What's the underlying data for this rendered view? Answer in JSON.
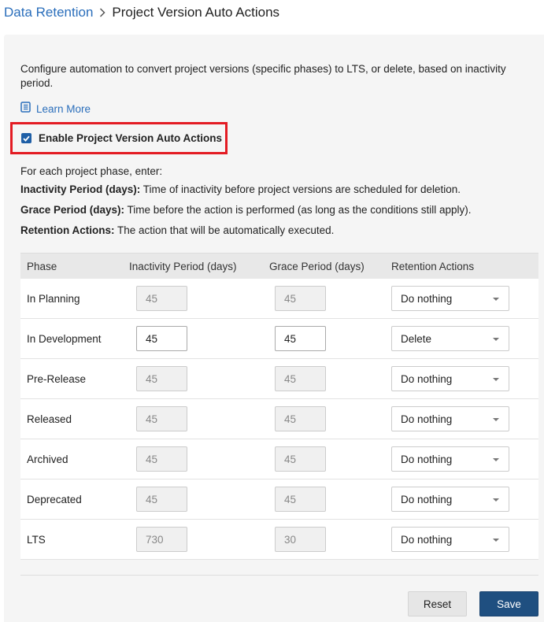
{
  "breadcrumb": {
    "parent": "Data Retention",
    "current": "Project Version Auto Actions"
  },
  "description": "Configure automation to convert project versions (specific phases) to LTS, or delete, based on inactivity period.",
  "learn_more": "Learn More",
  "enable": {
    "label": "Enable Project Version Auto Actions",
    "checked": true
  },
  "instructions": {
    "intro": "For each project phase, enter:",
    "items": [
      {
        "term": "Inactivity Period (days):",
        "text": " Time of inactivity before project versions are scheduled for deletion."
      },
      {
        "term": "Grace Period (days):",
        "text": " Time before the action is performed (as long as the conditions still apply)."
      },
      {
        "term": "Retention Actions:",
        "text": " The action that will be automatically executed."
      }
    ]
  },
  "table": {
    "headers": {
      "phase": "Phase",
      "inactivity": "Inactivity Period (days)",
      "grace": "Grace Period (days)",
      "action": "Retention Actions"
    },
    "rows": [
      {
        "phase": "In Planning",
        "inactivity": "45",
        "grace": "45",
        "action": "Do nothing",
        "editable": false
      },
      {
        "phase": "In Development",
        "inactivity": "45",
        "grace": "45",
        "action": "Delete",
        "editable": true
      },
      {
        "phase": "Pre-Release",
        "inactivity": "45",
        "grace": "45",
        "action": "Do nothing",
        "editable": false
      },
      {
        "phase": "Released",
        "inactivity": "45",
        "grace": "45",
        "action": "Do nothing",
        "editable": false
      },
      {
        "phase": "Archived",
        "inactivity": "45",
        "grace": "45",
        "action": "Do nothing",
        "editable": false
      },
      {
        "phase": "Deprecated",
        "inactivity": "45",
        "grace": "45",
        "action": "Do nothing",
        "editable": false
      },
      {
        "phase": "LTS",
        "inactivity": "730",
        "grace": "30",
        "action": "Do nothing",
        "editable": false
      }
    ]
  },
  "buttons": {
    "reset": "Reset",
    "save": "Save"
  },
  "colors": {
    "link": "#2a6ebb",
    "highlight": "#e31b23",
    "primary": "#1f4f80"
  }
}
